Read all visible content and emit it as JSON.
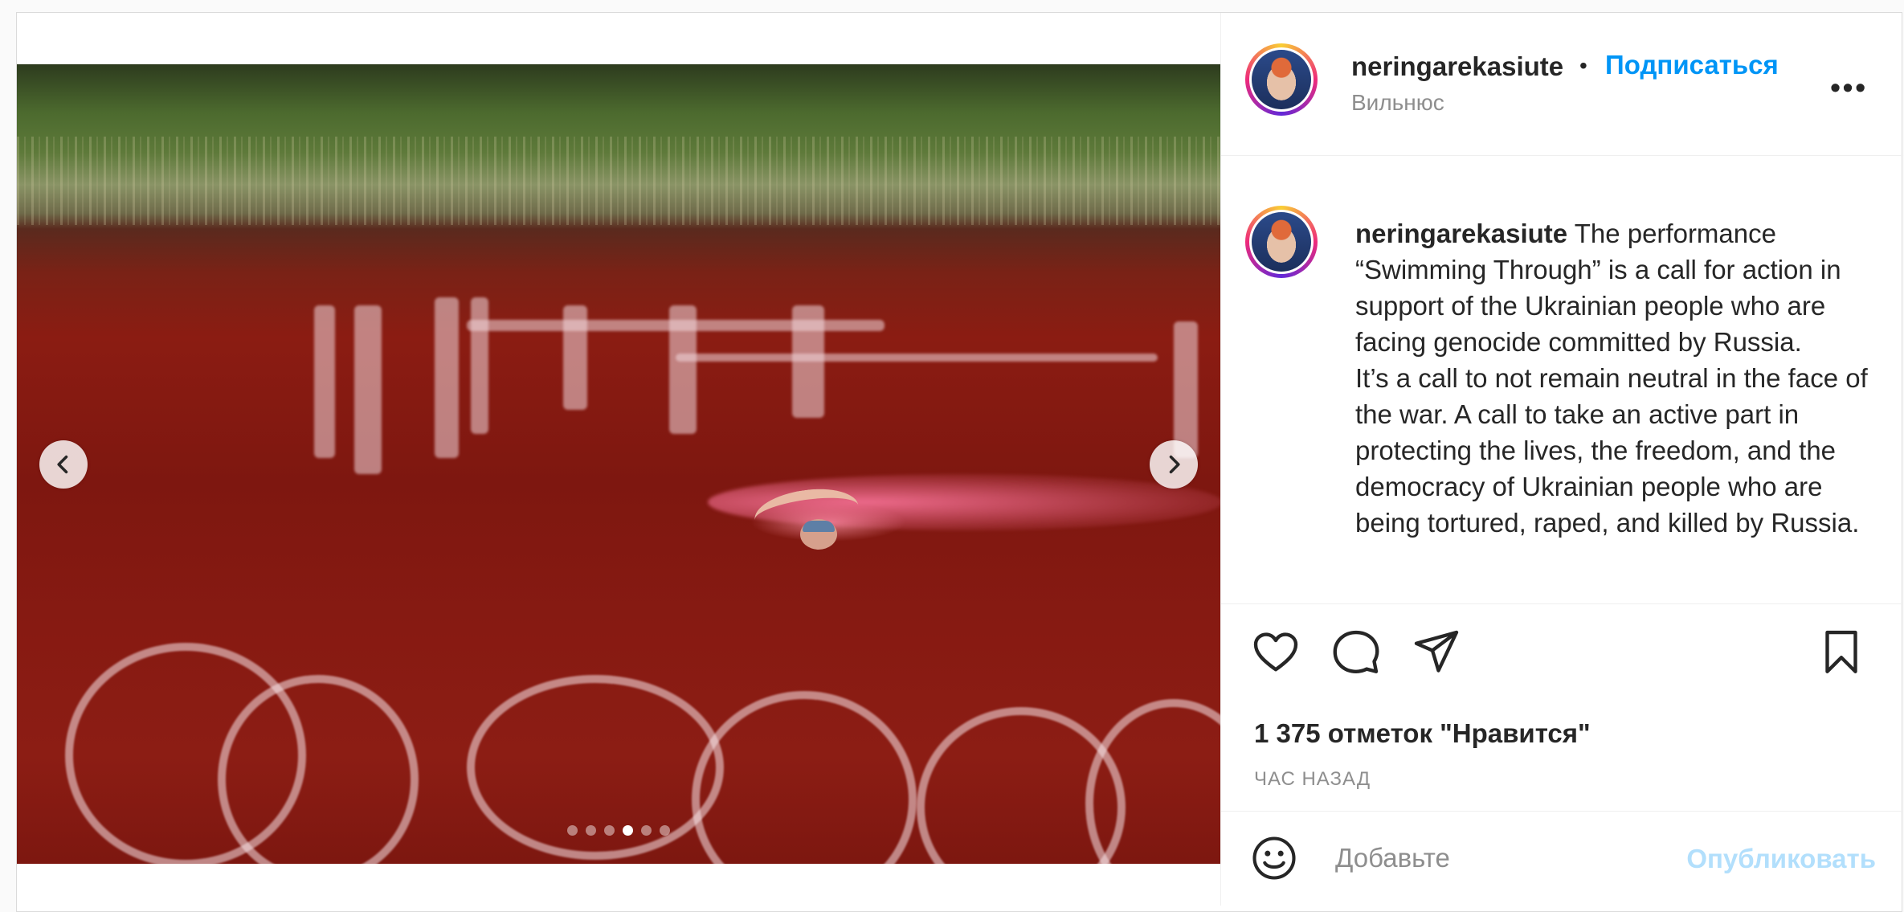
{
  "post": {
    "user": "neringarekasiute",
    "follow_label": "Подписаться",
    "separator": "•",
    "location": "Вильнюс",
    "more_icon": "more-options-icon",
    "caption_user": "neringarekasiute",
    "caption_text": " The performance “Swimming Through” is a call for action in support of the Ukrainian people who are facing genocide committed by Russia.\nIt’s a call to not remain neutral in the face of the war. A call to take an active part in protecting the lives, the freedom, and the democracy of Ukrainian people who are being tortured, raped, and killed by Russia.",
    "likes": "1 375 отметок \"Нравится\"",
    "time_ago": "ЧАС НАЗАД",
    "comment_placeholder": "Добавьте",
    "publish_label": "Опубликовать",
    "carousel": {
      "count": 6,
      "active_index": 3
    },
    "icons": {
      "prev": "chevron-left-icon",
      "next": "chevron-right-icon",
      "like": "heart-icon",
      "comment": "comment-icon",
      "share": "send-icon",
      "save": "bookmark-icon",
      "emoji": "emoji-icon"
    },
    "colors": {
      "accent": "#0095f6",
      "publish_disabled": "#b2dffc",
      "secondary_text": "#8e8e8e",
      "text": "#262626",
      "border": "#dbdbdb"
    }
  }
}
